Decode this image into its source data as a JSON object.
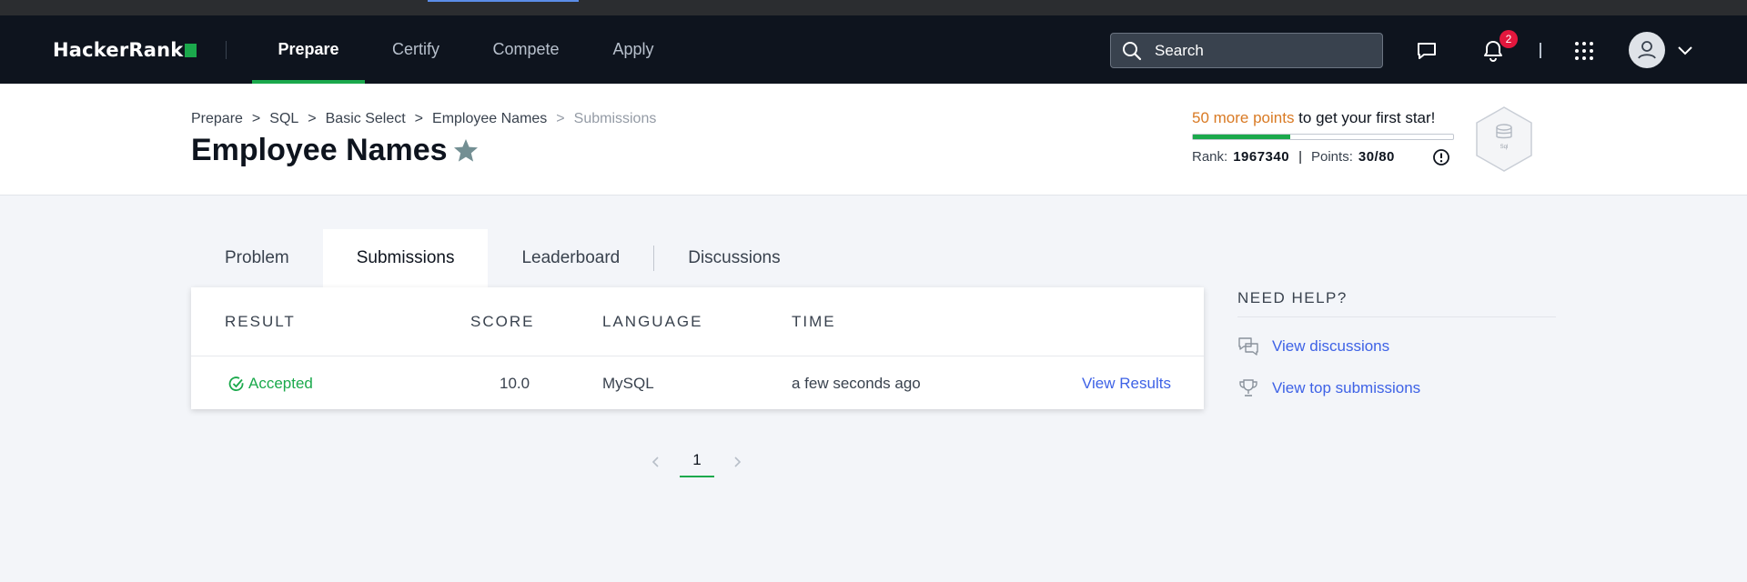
{
  "navbar": {
    "logo": "HackerRank",
    "links": [
      {
        "label": "Prepare",
        "active": true
      },
      {
        "label": "Certify",
        "active": false
      },
      {
        "label": "Compete",
        "active": false
      },
      {
        "label": "Apply",
        "active": false
      }
    ],
    "search_placeholder": "Search",
    "notification_count": "2",
    "icons": [
      "chat-icon",
      "bell-icon",
      "apps-grid-icon",
      "user-avatar-icon",
      "chevron-down-icon"
    ]
  },
  "header": {
    "breadcrumbs": [
      "Prepare",
      "SQL",
      "Basic Select",
      "Employee Names",
      "Submissions"
    ],
    "title": "Employee Names",
    "progress": {
      "highlight": "50 more points",
      "rest": " to get your first star!",
      "fraction": 0.375
    },
    "rank_label": "Rank:",
    "rank_value": "1967340",
    "points_label": "Points:",
    "points_value": "30/80",
    "badge_label": "Sql"
  },
  "tabs": [
    {
      "label": "Problem",
      "active": false
    },
    {
      "label": "Submissions",
      "active": true
    },
    {
      "label": "Leaderboard",
      "active": false
    },
    {
      "label": "Discussions",
      "active": false
    }
  ],
  "submissions": {
    "columns": [
      "RESULT",
      "SCORE",
      "LANGUAGE",
      "TIME"
    ],
    "rows": [
      {
        "result": "Accepted",
        "score": "10.0",
        "language": "MySQL",
        "time": "a few seconds ago",
        "action": "View Results"
      }
    ]
  },
  "pagination": {
    "current": "1"
  },
  "help": {
    "title": "NEED HELP?",
    "items": [
      "View discussions",
      "View top submissions"
    ]
  },
  "colors": {
    "accent_green": "#1ba94c",
    "link_blue": "#3e62e6",
    "nav_bg": "#0e141e",
    "points_orange": "#d97a24"
  }
}
